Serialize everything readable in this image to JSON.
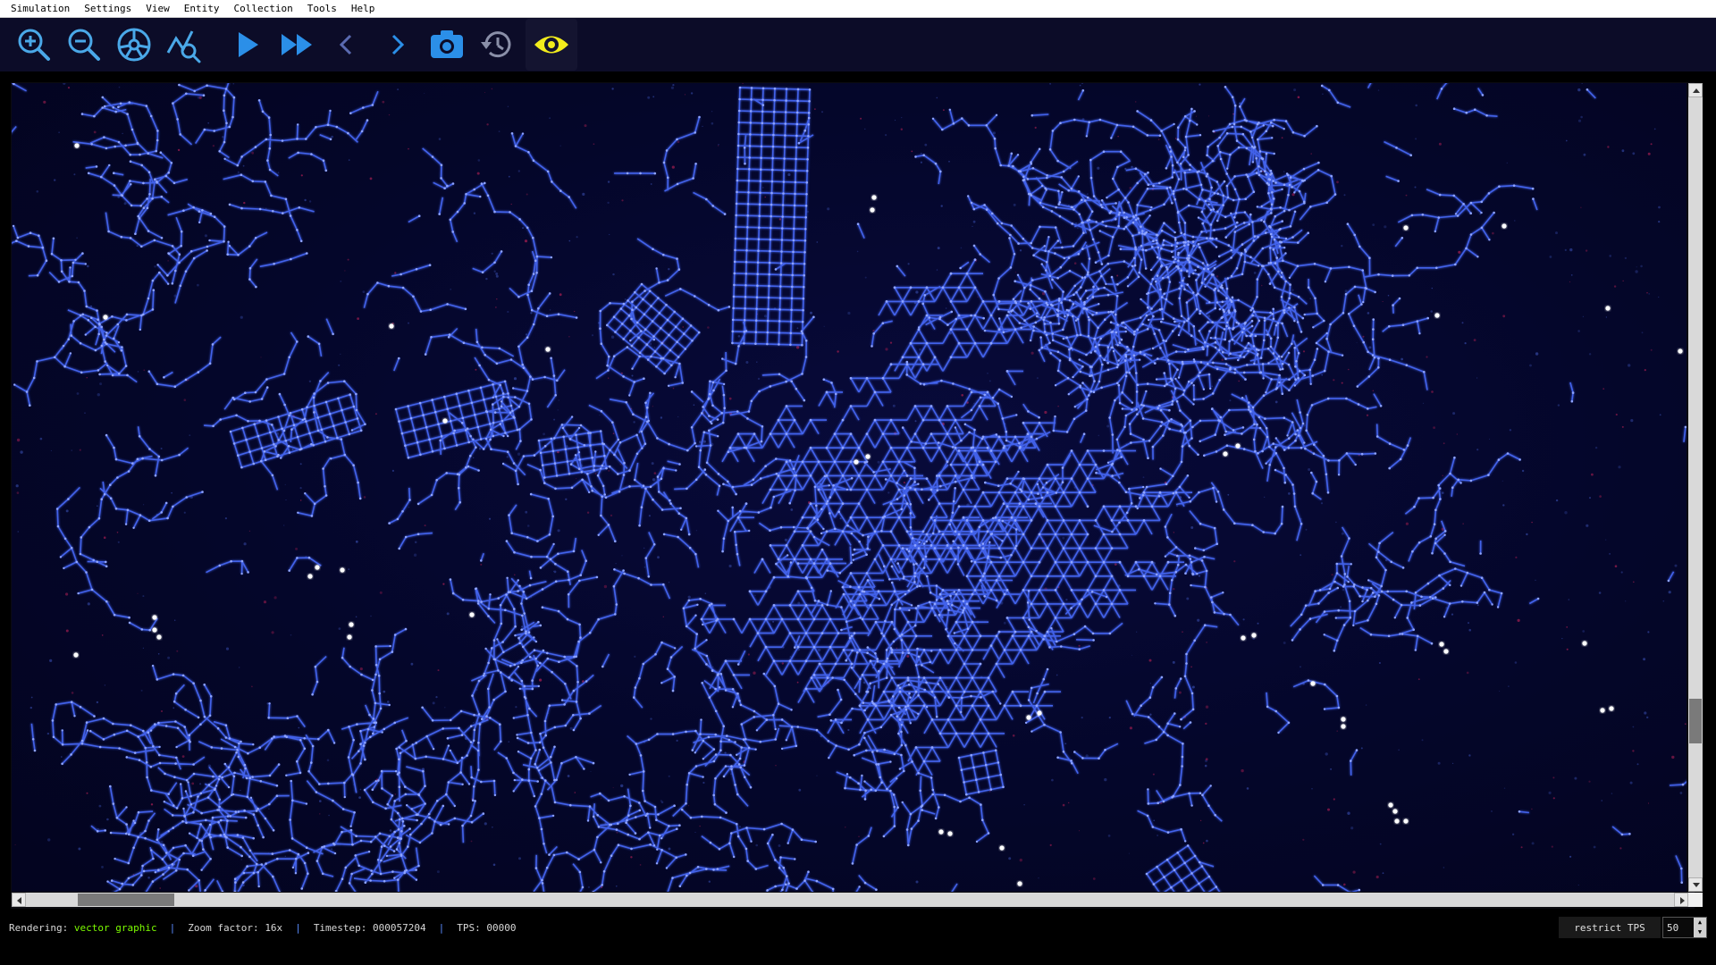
{
  "menu": [
    "Simulation",
    "Settings",
    "View",
    "Entity",
    "Collection",
    "Tools",
    "Help"
  ],
  "toolbar": {
    "icons": [
      "zoom-in-icon",
      "zoom-out-icon",
      "steering-wheel-icon",
      "zoom-curve-icon",
      "play-icon",
      "fast-forward-icon",
      "chevron-left-icon",
      "chevron-right-icon",
      "camera-icon",
      "history-icon",
      "eye-icon"
    ],
    "accent": "#3ba0ff",
    "eye_color": "#f2ec1c"
  },
  "status": {
    "rendering_label": "Rendering:",
    "rendering_value": "vector graphic",
    "zoom_label": "Zoom factor:",
    "zoom_value": "16x",
    "timestep_label": "Timestep:",
    "timestep_value": "000057204",
    "tps_label": "TPS:",
    "tps_value": "00000",
    "separator": "|"
  },
  "tps_control": {
    "button_label": "restrict TPS",
    "value": "50"
  },
  "colors": {
    "edge": "#4a6cff",
    "node_glow": "#8fa4ff",
    "particle": "#ffffff",
    "energy": "#8a1a4a",
    "background": "#03041f"
  }
}
